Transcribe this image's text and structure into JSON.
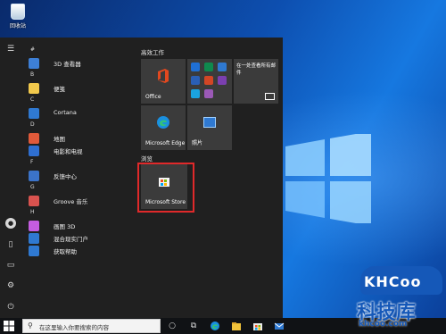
{
  "desktop": {
    "recycle_bin_label": "回收站"
  },
  "start_menu": {
    "app_list": [
      {
        "kind": "header",
        "text": "#"
      },
      {
        "kind": "app",
        "name": "3D 查看器",
        "icon": "cube-icon",
        "color": "#3d7fd6"
      },
      {
        "kind": "header",
        "text": "B"
      },
      {
        "kind": "app",
        "name": "便笺",
        "icon": "sticky-notes-icon",
        "color": "#f2c94c"
      },
      {
        "kind": "header",
        "text": "C"
      },
      {
        "kind": "app",
        "name": "Cortana",
        "icon": "cortana-icon",
        "color": "#2f79d1"
      },
      {
        "kind": "header",
        "text": "D"
      },
      {
        "kind": "app",
        "name": "地图",
        "icon": "map-pin-icon",
        "color": "#e05a3a"
      },
      {
        "kind": "app",
        "name": "电影和电视",
        "icon": "film-icon",
        "color": "#2f6fd0"
      },
      {
        "kind": "header",
        "text": "F"
      },
      {
        "kind": "app",
        "name": "反馈中心",
        "icon": "feedback-icon",
        "color": "#3b73c9",
        "has_chevron": false
      },
      {
        "kind": "header",
        "text": "G"
      },
      {
        "kind": "app",
        "name": "Groove 音乐",
        "icon": "music-disc-icon",
        "color": "#d9534f"
      },
      {
        "kind": "header",
        "text": "H"
      },
      {
        "kind": "app",
        "name": "画图 3D",
        "icon": "paint-3d-icon",
        "color": "#c55de0"
      },
      {
        "kind": "app",
        "name": "混合现实门户",
        "icon": "mixed-reality-icon",
        "color": "#2f79d1"
      },
      {
        "kind": "app",
        "name": "获取帮助",
        "icon": "help-icon",
        "color": "#2f79d1"
      }
    ],
    "groups": [
      {
        "title": "高效工作"
      },
      {
        "title": "浏览"
      }
    ],
    "tiles": {
      "office": "Office",
      "mail_text": "在一处查看所有邮件",
      "edge": "Microsoft Edge",
      "photos": "照片",
      "store": "Microsoft Store"
    }
  },
  "taskbar": {
    "search_placeholder": "在这里输入你要搜索的内容"
  },
  "watermark": {
    "en": "KHCoo",
    "cn": "科技库",
    "url": "khcoo.com"
  }
}
